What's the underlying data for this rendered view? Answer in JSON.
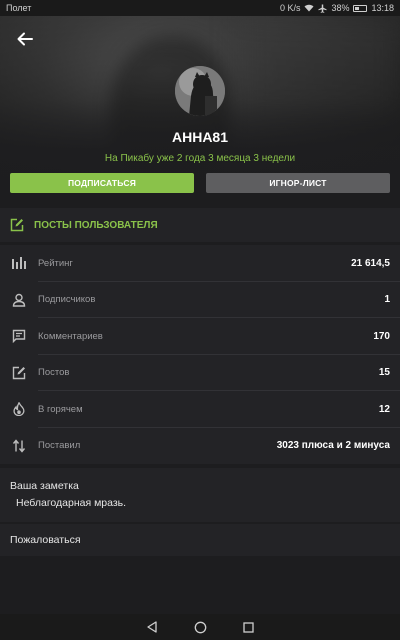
{
  "status": {
    "carrier": "Полет",
    "speed": "0 K/s",
    "battery": "38%",
    "battery_level": 0.38,
    "time": "13:18"
  },
  "profile": {
    "username": "АННА81",
    "since": "На Пикабу уже 2 года 3 месяца 3 недели",
    "subscribe_label": "ПОДПИСАТЬСЯ",
    "ignore_label": "ИГНОР-ЛИСТ"
  },
  "posts_link": {
    "label": "ПОСТЫ ПОЛЬЗОВАТЕЛЯ",
    "icon": "edit-icon"
  },
  "stats": [
    {
      "icon": "bar-chart-icon",
      "label": "Рейтинг",
      "value": "21 614,5"
    },
    {
      "icon": "person-icon",
      "label": "Подписчиков",
      "value": "1"
    },
    {
      "icon": "comment-icon",
      "label": "Комментариев",
      "value": "170"
    },
    {
      "icon": "edit-icon",
      "label": "Постов",
      "value": "15"
    },
    {
      "icon": "fire-icon",
      "label": "В горячем",
      "value": "12"
    },
    {
      "icon": "up-down-arrows-icon",
      "label": "Поставил",
      "value": "3023 плюса и 2 минуса"
    }
  ],
  "note": {
    "title": "Ваша заметка",
    "text": "Неблагодарная мразь."
  },
  "report": {
    "label": "Пожаловаться"
  },
  "colors": {
    "accent": "#8ac24a",
    "background": "#1d1d1f",
    "card": "#232326",
    "ignore_button": "#5e5e60"
  }
}
